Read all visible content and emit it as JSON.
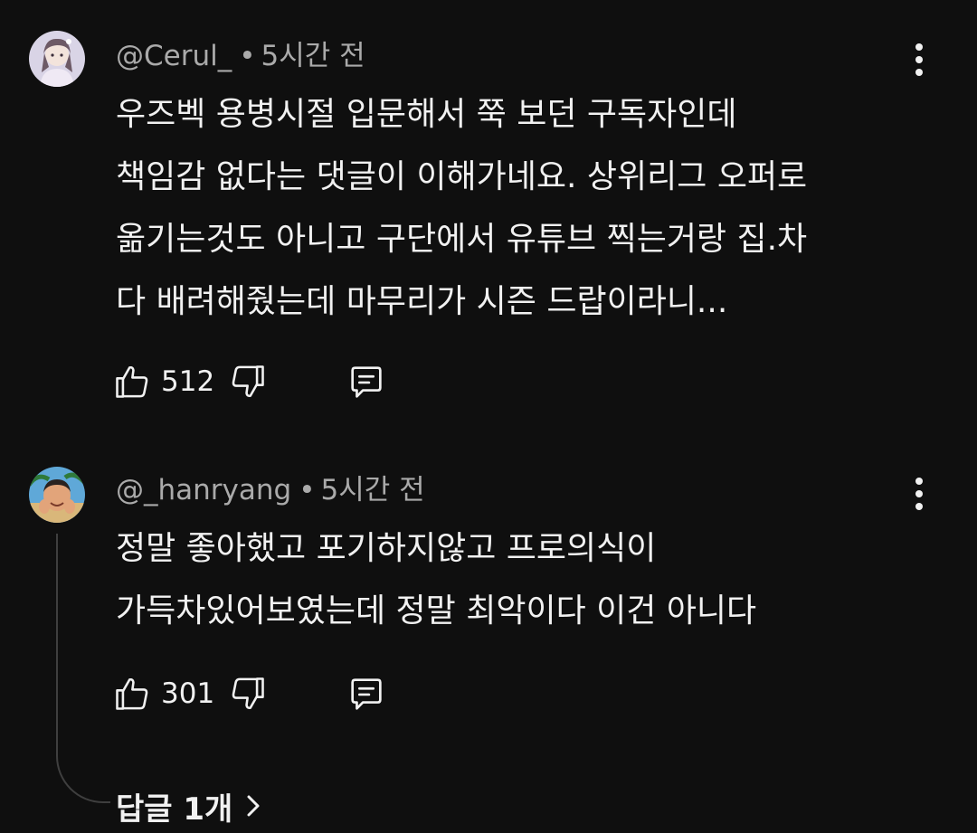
{
  "comments": [
    {
      "author": "@Cerul_",
      "separator": "•",
      "time": "5시간 전",
      "lines": [
        "우즈벡 용병시절 입문해서 쭉 보던 구독자인데",
        "책임감 없다는 댓글이 이해가네요. 상위리그 오퍼로",
        "옮기는것도 아니고 구단에서 유튜브 찍는거랑 집.차",
        "다 배려해줬는데 마무리가 시즌 드랍이라니..."
      ],
      "likes": "512",
      "avatar_icon": "anime-girl-avatar"
    },
    {
      "author": "@_hanryang",
      "separator": "•",
      "time": "5시간 전",
      "lines": [
        "정말 좋아했고 포기하지않고 프로의식이",
        "가득차있어보였는데 정말 최악이다 이건 아니다"
      ],
      "likes": "301",
      "avatar_icon": "beach-person-avatar"
    }
  ],
  "replies": {
    "label": "답글 1개",
    "icon": "chevron-right-icon"
  },
  "colors": {
    "background": "#0f0f0f",
    "primary_text": "#f1f1f1",
    "secondary_text": "#aaaaaa",
    "thread_line": "#3f3f3f"
  }
}
